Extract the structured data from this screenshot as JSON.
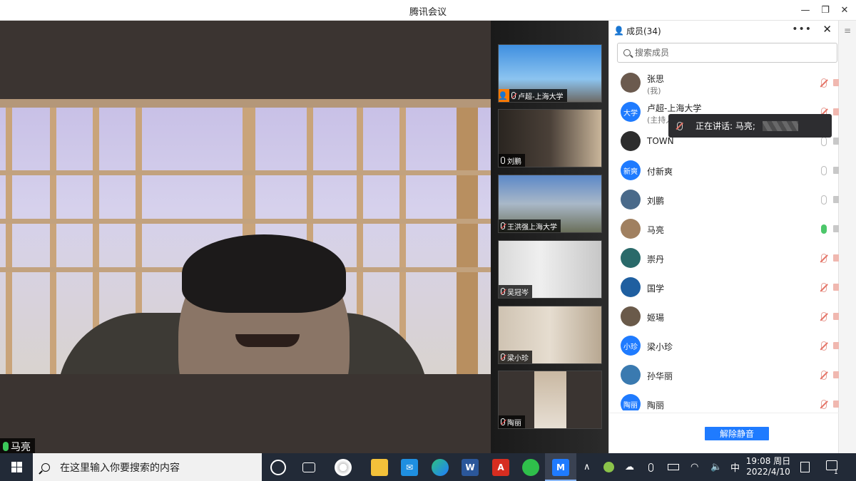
{
  "window": {
    "title": "腾讯会议"
  },
  "main_video": {
    "speaker_name": "马亮"
  },
  "thumbnails": [
    {
      "name": "卢超-上海大学",
      "host": true,
      "muted": true
    },
    {
      "name": "刘鹏",
      "host": false,
      "muted": false
    },
    {
      "name": "王洪强上海大学",
      "host": false,
      "muted": true
    },
    {
      "name": "吴冠岑",
      "host": false,
      "muted": true
    },
    {
      "name": "梁小珍",
      "host": false,
      "muted": true
    },
    {
      "name": "陶丽",
      "host": false,
      "muted": true
    }
  ],
  "panel": {
    "title": "成员(34)",
    "more_icon": "more-horizontal-icon",
    "close_icon": "close-icon",
    "search_placeholder": "搜索成员",
    "members": [
      {
        "avatar_text": "",
        "name": "张思",
        "sub": "(我)",
        "mic": "muted",
        "cam": "off"
      },
      {
        "avatar_text": "大学",
        "name": "卢超-上海大学",
        "sub": "(主持人)",
        "mic": "muted",
        "cam": "off"
      },
      {
        "avatar_text": "",
        "name": "TOWN",
        "sub": "",
        "mic": "idle",
        "cam": "idle"
      },
      {
        "avatar_text": "新爽",
        "name": "付新爽",
        "sub": "",
        "mic": "idle",
        "cam": "idle"
      },
      {
        "avatar_text": "",
        "name": "刘鹏",
        "sub": "",
        "mic": "idle",
        "cam": "idle"
      },
      {
        "avatar_text": "",
        "name": "马亮",
        "sub": "",
        "mic": "on",
        "cam": "idle"
      },
      {
        "avatar_text": "",
        "name": "崇丹",
        "sub": "",
        "mic": "muted",
        "cam": "off"
      },
      {
        "avatar_text": "",
        "name": "国学",
        "sub": "",
        "mic": "muted",
        "cam": "off"
      },
      {
        "avatar_text": "",
        "name": "姬瑒",
        "sub": "",
        "mic": "muted",
        "cam": "off"
      },
      {
        "avatar_text": "小珍",
        "name": "梁小珍",
        "sub": "",
        "mic": "muted",
        "cam": "off"
      },
      {
        "avatar_text": "",
        "name": "孙华丽",
        "sub": "",
        "mic": "muted",
        "cam": "off"
      },
      {
        "avatar_text": "陶丽",
        "name": "陶丽",
        "sub": "",
        "mic": "muted",
        "cam": "off"
      }
    ],
    "speaking_tooltip": "正在讲话: 马亮;",
    "unmute_all_label": "解除静音"
  },
  "taskbar": {
    "search_placeholder": "在这里输入你要搜索的内容",
    "ime_label": "中",
    "time": "19:08 周日",
    "date": "2022/4/10",
    "notification_badge": "1",
    "apps": [
      "cortana-icon",
      "task-view-icon",
      "pinwheel-app-icon",
      "file-explorer-icon",
      "mail-icon",
      "edge-icon",
      "word-icon",
      "acrobat-icon",
      "wechat-icon",
      "tencent-meeting-icon"
    ]
  },
  "colors": {
    "accent": "#1f7bff",
    "mic_active": "#4cc76a",
    "muted": "#e57467",
    "host": "#ff7a00"
  }
}
